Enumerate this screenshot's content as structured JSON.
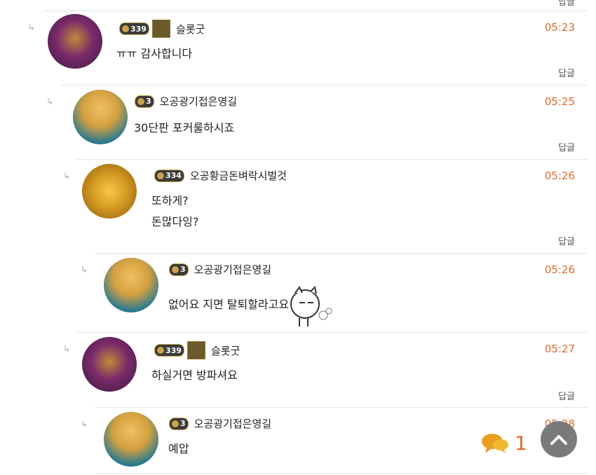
{
  "reply_label": "답글",
  "comments": [
    {
      "level": "339",
      "nick": "슬롯굿",
      "time": "05:23",
      "lines": [
        "ㅠㅠ 감사합니다"
      ],
      "badge": "trophy"
    },
    {
      "level": "3",
      "nick": "오공광기접은영길",
      "time": "05:25",
      "lines": [
        "30단판 포커룰하시죠"
      ],
      "badge": "none"
    },
    {
      "level": "334",
      "nick": "오공황금돈벼락시벌것",
      "time": "05:26",
      "lines": [
        "또하게?",
        "돈많다잉?"
      ],
      "badge": "none"
    },
    {
      "level": "3",
      "nick": "오공광기접은영길",
      "time": "05:26",
      "lines": [
        "없어요 지면 탈퇴할라고요"
      ],
      "badge": "none"
    },
    {
      "level": "339",
      "nick": "슬롯굿",
      "time": "05:27",
      "lines": [
        "하실거면 방파셔요"
      ],
      "badge": "trophy"
    },
    {
      "level": "3",
      "nick": "오공광기접은영길",
      "time": "05:28",
      "lines": [
        "예압"
      ],
      "badge": "none"
    }
  ],
  "chat_count": "1",
  "colors": {
    "time": "#e06a28",
    "fab": "#7a7a7a"
  }
}
